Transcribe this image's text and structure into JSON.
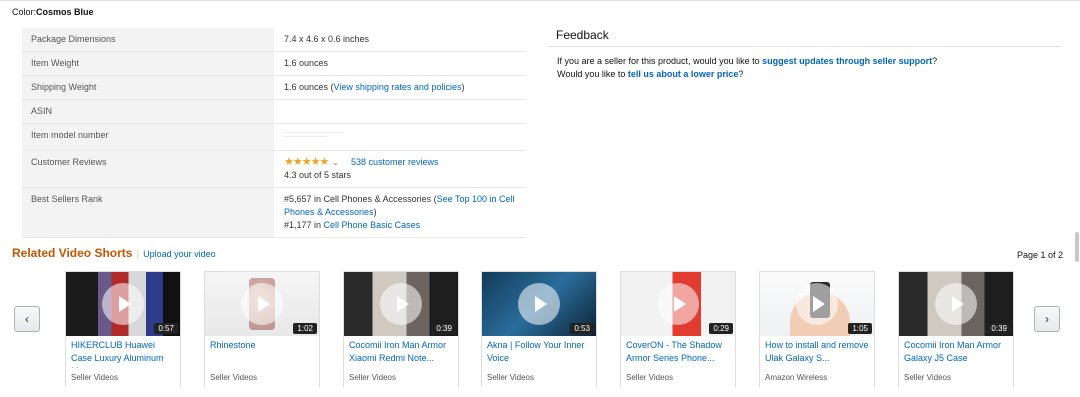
{
  "color": {
    "label": "Color:",
    "value": "Cosmos Blue"
  },
  "details": {
    "package_dimensions": {
      "label": "Package Dimensions",
      "value": "7.4 x 4.6 x 0.6 inches"
    },
    "item_weight": {
      "label": "Item Weight",
      "value": "1.6 ounces"
    },
    "shipping_weight": {
      "label": "Shipping Weight",
      "value": "1.6 ounces (",
      "link": "View shipping rates and policies",
      "suffix": ")"
    },
    "asin": {
      "label": "ASIN",
      "value": ""
    },
    "item_model_number": {
      "label": "Item model number",
      "value": ""
    },
    "customer_reviews": {
      "label": "Customer Reviews",
      "stars": "★★★★★",
      "rating": 4.3,
      "rating_text": "4.3 out of 5 stars",
      "link": "538 customer reviews"
    },
    "best_sellers_rank": {
      "label": "Best Sellers Rank",
      "line1_prefix": "#5,657 in Cell Phones & Accessories (",
      "line1_link": "See Top 100 in Cell Phones & Accessories",
      "line1_suffix": ")",
      "line2_prefix": "#1,177 in ",
      "line2_link": "Cell Phone Basic Cases"
    }
  },
  "feedback": {
    "title": "Feedback",
    "line1_prefix": "If you are a seller for this product, would you like to ",
    "line1_link": "suggest updates through seller support",
    "line1_suffix": "?",
    "line2_prefix": "Would you like to ",
    "line2_link": "tell us about a lower price",
    "line2_suffix": "?"
  },
  "related_videos": {
    "title": "Related Video Shorts",
    "separator": "|",
    "upload_link": "Upload your video",
    "page_indicator": "Page 1 of 2",
    "prev_icon": "chevron-left-icon",
    "next_icon": "chevron-right-icon",
    "videos": [
      {
        "title": "HIKERCLUB Huawei Case Luxury Aluminum Met...",
        "duration": "0:57",
        "source": "Seller Videos"
      },
      {
        "title": "Rhinestone",
        "duration": "1:02",
        "source": "Seller Videos"
      },
      {
        "title": "Cocomii Iron Man Armor Xiaomi Redmi Note...",
        "duration": "0:39",
        "source": "Seller Videos"
      },
      {
        "title": "Akna | Follow Your Inner Voice",
        "duration": "0:53",
        "source": "Seller Videos"
      },
      {
        "title": "CoverON - The Shadow Armor Series Phone...",
        "duration": "0:29",
        "source": "Seller Videos"
      },
      {
        "title": "How to install and remove Ulak Galaxy S...",
        "duration": "1:05",
        "source": "Amazon Wireless"
      },
      {
        "title": "Cocomii Iron Man Armor Galaxy J5 Case",
        "duration": "0:39",
        "source": "Seller Videos"
      }
    ]
  },
  "colors": {
    "link": "#0066c0",
    "heading_orange": "#c45500",
    "star": "#f0a41b"
  }
}
